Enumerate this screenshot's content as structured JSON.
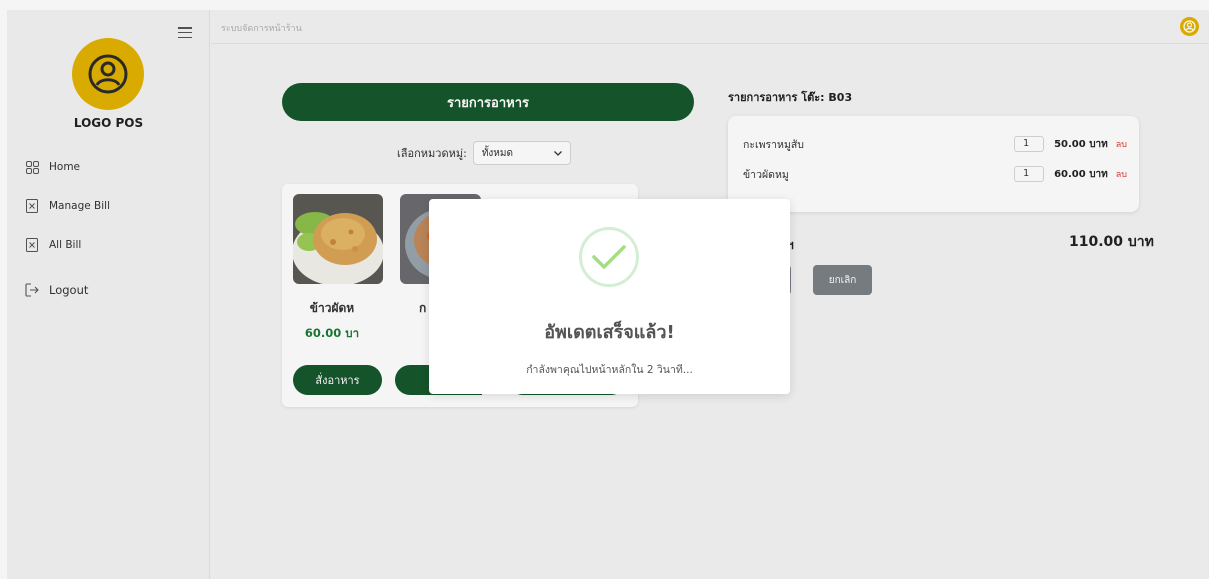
{
  "topbar": {
    "title": "ระบบจัดการหน้าร้าน"
  },
  "sidebar": {
    "logo_text": "LOGO POS",
    "items": [
      {
        "label": "Home",
        "icon": "grid-icon"
      },
      {
        "label": "Manage Bill",
        "icon": "bill-icon"
      },
      {
        "label": "All Bill",
        "icon": "bill-icon"
      },
      {
        "label": "Logout",
        "icon": "logout-icon"
      }
    ]
  },
  "menu": {
    "header": "รายการอาหาร",
    "category_label": "เลือกหมวดหมู่:",
    "category_value": "ทั้งหมด",
    "items": [
      {
        "name": "ข้าวผัดห",
        "price": "60.00 บา",
        "button": "สั่งอาหาร"
      },
      {
        "name": "ก",
        "price": "",
        "button": ""
      }
    ]
  },
  "order": {
    "title": "รายการอาหาร โต๊ะ: B03",
    "rows": [
      {
        "name": "กะเพราหมูสับ",
        "qty": "1",
        "price": "50.00 บาท",
        "delete": "ลบ"
      },
      {
        "name": "ข้าวผัดหมู",
        "qty": "1",
        "price": "60.00 บาท",
        "delete": "ลบ"
      }
    ],
    "total_label": "ฯ",
    "total_value": "110.00 บาท",
    "cancel_label": "ยกเลิก"
  },
  "modal": {
    "title": "อัพเดตเสร็จแล้ว!",
    "message": "กำลังพาคุณไปหน้าหลักใน 2 วินาที..."
  },
  "colors": {
    "brand_green": "#16582c",
    "accent_yellow": "#e2b200",
    "price_green": "#1c7a36",
    "delete_red": "#e3342f",
    "success_green": "#a5dc86"
  }
}
